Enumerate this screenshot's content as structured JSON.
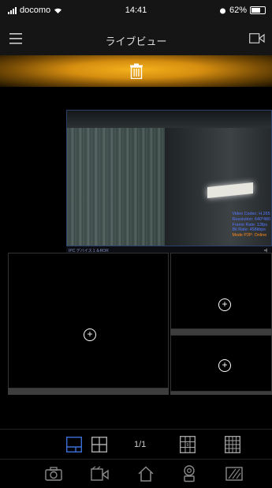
{
  "status_bar": {
    "carrier": "docomo",
    "time": "14:41",
    "battery": "62%"
  },
  "header": {
    "title": "ライブビュー",
    "menu_icon": "hamburger-menu-icon",
    "camera_icon": "video-camera-icon"
  },
  "delete_zone": {
    "icon": "trash-icon",
    "accent": "#f4b21c"
  },
  "live_view": {
    "info": {
      "codec": "Video Codec: H.265",
      "resolution": "Resolution: 640*480",
      "frame_rate": "Frame Rate: 13fps",
      "bit_rate": "Bit Rate: 458kbps",
      "mode": "Mode P2P: Online"
    },
    "camera_label": "IPC デバイス１＆ROR"
  },
  "grid_slots": {
    "plus": "+"
  },
  "layout_toolbar": {
    "page_indicator": "1/1"
  },
  "colors": {
    "accent_blue": "#3b6fd6",
    "icon_gray": "#8a8a8a"
  }
}
